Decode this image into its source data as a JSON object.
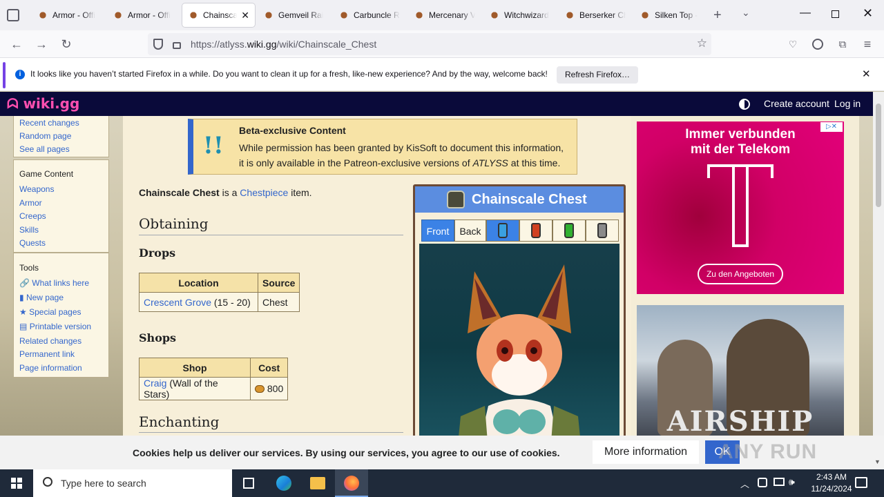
{
  "browser": {
    "tabs": [
      {
        "title": "Armor - Offi"
      },
      {
        "title": "Armor - Offi"
      },
      {
        "title": "Chainscal"
      },
      {
        "title": "Gemveil Rai"
      },
      {
        "title": "Carbuncle R"
      },
      {
        "title": "Mercenary V"
      },
      {
        "title": "Witchwizard"
      },
      {
        "title": "Berserker Ch"
      },
      {
        "title": "Silken Top -"
      }
    ],
    "url_prefix": "https://atlyss.",
    "url_domain": "wiki.gg",
    "url_path": "/wiki/Chainscale_Chest",
    "notification": "It looks like you haven’t started Firefox in a while. Do you want to clean it up for a fresh, like-new experience? And by the way, welcome back!",
    "refresh_button": "Refresh Firefox…"
  },
  "site": {
    "logo": "wiki.gg",
    "create_account": "Create account",
    "login": "Log in"
  },
  "sidebar": {
    "nav_items": [
      "Recent changes",
      "Random page",
      "See all pages"
    ],
    "game_heading": "Game Content",
    "game_items": [
      "Weapons",
      "Armor",
      "Creeps",
      "Skills",
      "Quests"
    ],
    "tools_heading": "Tools",
    "tools_items": [
      "What links here",
      "New page",
      "Special pages",
      "Printable version",
      "Related changes",
      "Permanent link",
      "Page information"
    ]
  },
  "notice": {
    "title": "Beta-exclusive Content",
    "line1": "While permission has been granted by KisSoft to document this information,",
    "line2a": "it is only available in the Patreon-exclusive versions of ",
    "line2b": "ATLYSS",
    "line2c": " at this time."
  },
  "article": {
    "intro_bold": "Chainscale Chest",
    "intro_mid": " is a ",
    "intro_link": "Chestpiece",
    "intro_end": " item.",
    "h_obtaining": "Obtaining",
    "h_drops": "Drops",
    "drops_headers": [
      "Location",
      "Source"
    ],
    "drops_row": {
      "link": "Crescent Grove",
      "level": " (15 - 20)",
      "source": "Chest"
    },
    "h_shops": "Shops",
    "shops_headers": [
      "Shop",
      "Cost"
    ],
    "shops_row": {
      "link": "Craig",
      "place": " (Wall of the Stars)",
      "cost": "800"
    },
    "h_enchanting": "Enchanting"
  },
  "infobox": {
    "title": "Chainscale Chest",
    "tab_front": "Front",
    "tab_back": "Back",
    "potion_colors": [
      "#3aa0e0",
      "#d04020",
      "#30b030",
      "#8a8a8a"
    ]
  },
  "ads": {
    "telekom_line1": "Immer verbunden",
    "telekom_line2": "mit der Telekom",
    "telekom_button": "Zu den Angeboten",
    "airship_text": "AIRSHIP"
  },
  "cookie": {
    "text": "Cookies help us deliver our services. By using our services, you agree to our use of cookies.",
    "more": "More information",
    "ok": "OK"
  },
  "taskbar": {
    "search_placeholder": "Type here to search",
    "time": "2:43 AM",
    "date": "11/24/2024"
  },
  "watermark": "ANY RUN"
}
